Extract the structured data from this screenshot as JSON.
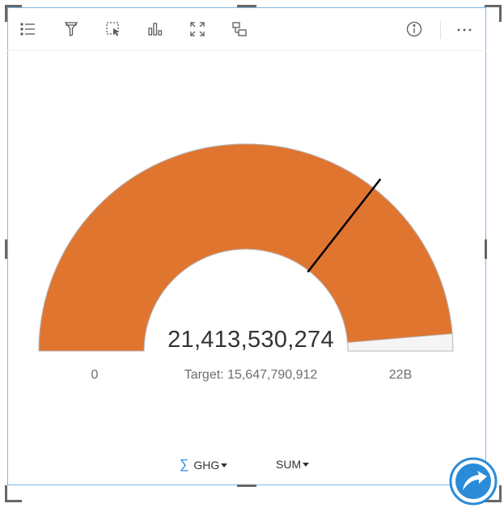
{
  "toolbar": {
    "icons": [
      "legend-icon",
      "filter-icon",
      "select-icon",
      "visualization-type-icon",
      "maximize-icon",
      "flip-card-icon",
      "info-icon",
      "more-options-icon"
    ]
  },
  "gauge": {
    "value_text": "21,413,530,274",
    "target_text": "Target: 15,647,790,912",
    "min_label": "0",
    "max_label": "22B",
    "value": 21413530274,
    "target": 15647790912,
    "min": 0,
    "max": 22000000000,
    "fill_color": "#e07530",
    "empty_color": "#f5f5f5",
    "outline_color": "#b7b7b7",
    "target_line_color": "#000000"
  },
  "footer": {
    "field_label": "GHG",
    "statistic_label": "SUM"
  },
  "colors": {
    "accent": "#2a8bd8",
    "card_border": "#7fb8e6"
  }
}
